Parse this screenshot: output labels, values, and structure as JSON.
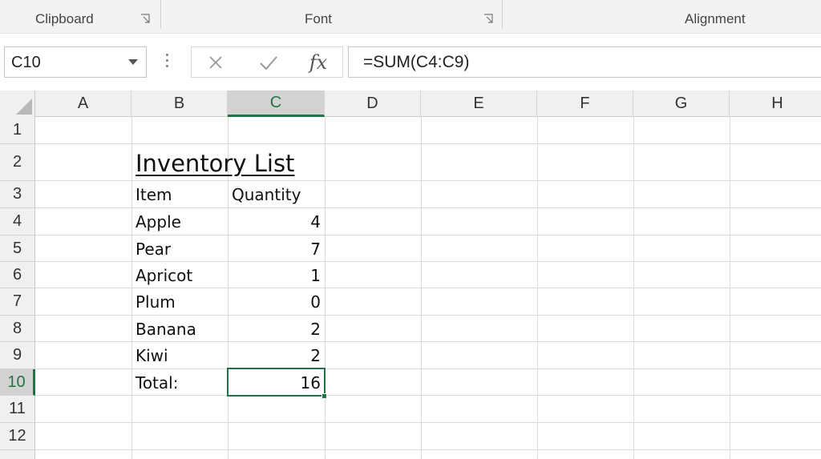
{
  "ribbon": {
    "groups": [
      "Clipboard",
      "Font",
      "Alignment"
    ]
  },
  "namebox": {
    "value": "C10"
  },
  "formula_bar": {
    "cancel_icon": "cancel-x-icon",
    "enter_icon": "check-icon",
    "fx_label": "fx",
    "formula": "=SUM(C4:C9)"
  },
  "columns": [
    "A",
    "B",
    "C",
    "D",
    "E",
    "F",
    "G",
    "H"
  ],
  "rows": [
    "1",
    "2",
    "3",
    "4",
    "5",
    "6",
    "7",
    "8",
    "9",
    "10",
    "11",
    "12"
  ],
  "sheet": {
    "title": "Inventory List",
    "header_item": "Item",
    "header_qty": "Quantity",
    "items": [
      {
        "name": "Apple",
        "qty": "4"
      },
      {
        "name": "Pear",
        "qty": "7"
      },
      {
        "name": "Apricot",
        "qty": "1"
      },
      {
        "name": "Plum",
        "qty": "0"
      },
      {
        "name": "Banana",
        "qty": "2"
      },
      {
        "name": "Kiwi",
        "qty": "2"
      }
    ],
    "total_label": "Total:",
    "total_value": "16"
  },
  "colors": {
    "accent": "#217346"
  }
}
